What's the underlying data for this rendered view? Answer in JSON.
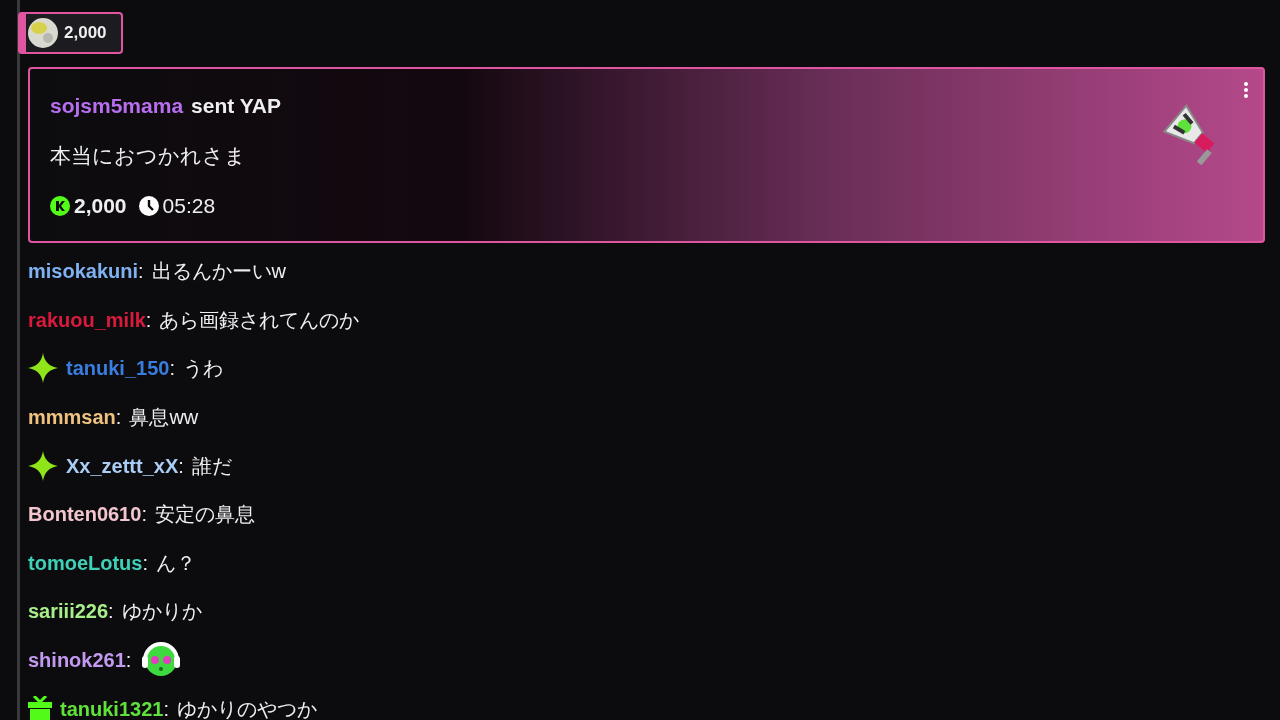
{
  "pinned_gift": {
    "amount": "2,000"
  },
  "yap_card": {
    "sender": "sojsm5mama",
    "action": "sent YAP",
    "message": "本当におつかれさま",
    "amount": "2,000",
    "time": "05:28"
  },
  "messages": [
    {
      "kind": "plain",
      "username": "misokakuni",
      "color": "#7fb2f0",
      "colon": ":",
      "text": "出るんかーいw"
    },
    {
      "kind": "plain",
      "username": "rakuou_milk",
      "color": "#d81b3c",
      "colon": ":",
      "text": "あら画録されてんのか"
    },
    {
      "kind": "sparkle",
      "username": "tanuki_150",
      "color": "#3a7de0",
      "colon": ":",
      "text": "うわ"
    },
    {
      "kind": "plain",
      "username": "mmmsan",
      "color": "#f0c27f",
      "colon": ":",
      "text": "鼻息ww"
    },
    {
      "kind": "sparkle",
      "username": "Xx_zettt_xX",
      "color": "#a9cdf5",
      "colon": ":",
      "text": "誰だ"
    },
    {
      "kind": "plain",
      "username": "Bonten0610",
      "color": "#f3c6cf",
      "colon": ":",
      "text": "安定の鼻息"
    },
    {
      "kind": "plain",
      "username": "tomoeLotus",
      "color": "#3fd0b8",
      "colon": ":",
      "text": "ん？"
    },
    {
      "kind": "plain",
      "username": "sariii226",
      "color": "#a8ef8a",
      "colon": ":",
      "text": "ゆかりか"
    },
    {
      "kind": "plain",
      "username": "shinok261",
      "color": "#c39af0",
      "colon": ":"
    },
    {
      "kind": "gift",
      "username": "tanuki1321",
      "color": "#5fe23a",
      "colon": ":",
      "text": "ゆかりのやつか"
    }
  ]
}
